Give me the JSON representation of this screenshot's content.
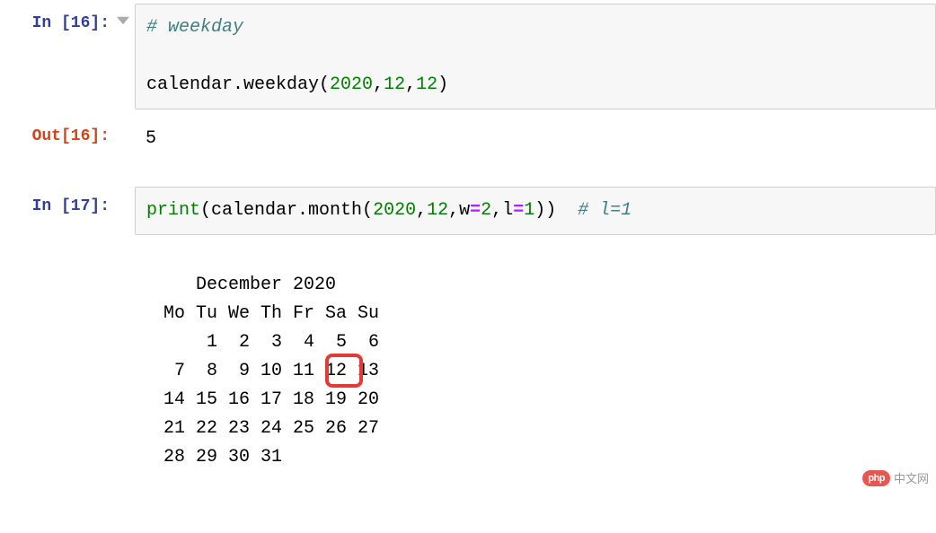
{
  "cell1": {
    "prompt_label": "In [",
    "prompt_num": "16",
    "prompt_close": "]:",
    "line1_comment": "# weekday",
    "line2_part1": "calendar.weekday(",
    "line2_arg1": "2020",
    "line2_c1": ",",
    "line2_arg2": "12",
    "line2_c2": ",",
    "line2_arg3": "12",
    "line2_close": ")"
  },
  "out1": {
    "prompt_label": "Out[",
    "prompt_num": "16",
    "prompt_close": "]:",
    "value": "5"
  },
  "cell2": {
    "prompt_label": "In [",
    "prompt_num": "17",
    "prompt_close": "]:",
    "p_print": "print",
    "p_open": "(",
    "p_call": "calendar.month(",
    "p_a1": "2020",
    "p_c1": ",",
    "p_a2": "12",
    "p_c2": ",",
    "p_kw1": "w",
    "p_eq1": "=",
    "p_v1": "2",
    "p_c3": ",",
    "p_kw2": "l",
    "p_eq2": "=",
    "p_v2": "1",
    "p_close": "))  ",
    "p_comment": "# l=1"
  },
  "output2": {
    "text": "   December 2020\nMo Tu We Th Fr Sa Su\n    1  2  3  4  5  6\n 7  8  9 10 11 12 13\n14 15 16 17 18 19 20\n21 22 23 24 25 26 27\n28 29 30 31"
  },
  "watermark": {
    "badge": "php",
    "text": "中文网"
  }
}
